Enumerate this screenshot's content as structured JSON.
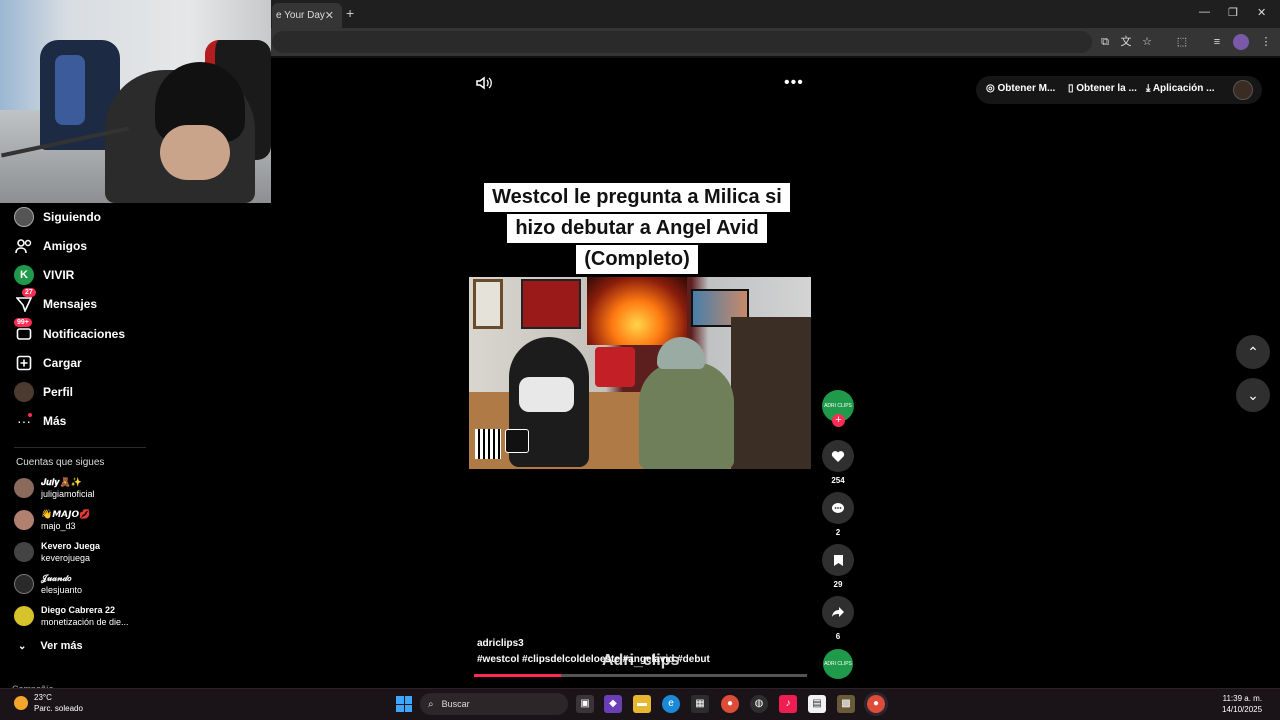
{
  "browser": {
    "tab_title": "e Your Day",
    "tab_close": "✕",
    "new_tab": "+",
    "window_controls": [
      "—",
      "❐",
      "✕"
    ]
  },
  "sidebar": {
    "items": [
      {
        "label": "Siguiendo",
        "icon": "following-icon"
      },
      {
        "label": "Amigos",
        "icon": "friends-icon"
      },
      {
        "label": "VIVIR",
        "icon": "live-icon",
        "glyph": "K"
      },
      {
        "label": "Mensajes",
        "icon": "messages-icon",
        "badge": "27"
      },
      {
        "label": "Notificaciones",
        "icon": "notifications-icon",
        "badge": "99+"
      },
      {
        "label": "Cargar",
        "icon": "upload-icon"
      },
      {
        "label": "Perfil",
        "icon": "profile-icon"
      },
      {
        "label": "Más",
        "icon": "more-icon"
      }
    ],
    "following_title": "Cuentas que sigues",
    "following": [
      {
        "nick": "𝑱𝒖𝒍𝒚🧸✨",
        "user": "juligiamoficial"
      },
      {
        "nick": "👋𝙈𝘼𝙅𝙊💋",
        "user": "majo_d3"
      },
      {
        "nick": "Kevero Juega",
        "user": "keverojuega"
      },
      {
        "nick": "𝒥𝓊𝒶𝓃𝒹𝑜",
        "user": "elesjuanto"
      },
      {
        "nick": "Diego Cabrera 22",
        "user": "monetización de die..."
      }
    ],
    "see_more": "Ver más",
    "cut_text": "Compañía"
  },
  "video": {
    "title_lines": [
      "Westcol le pregunta a Milica si",
      "hizo debutar a Angel Avid",
      "(Completo)"
    ],
    "author": "adriclips3",
    "hashtags": "#westcol  #clipsdelcoldeloeste #angelavid  #debut",
    "watermark": "Adri_clips",
    "progress": 0.26
  },
  "actions": {
    "creator_avatar_text": "ADRI CLIPS",
    "follow_plus": "+",
    "likes": "254",
    "comments": "2",
    "saves": "29",
    "shares": "6"
  },
  "top_right": {
    "btn1": "Obtener M...",
    "btn2": "Obtener la ...",
    "btn3": "Aplicación ..."
  },
  "taskbar": {
    "temp": "23°C",
    "weather": "Parc. soleado",
    "search_placeholder": "Buscar",
    "time": "11:39 a. m.",
    "date": "14/10/2025"
  }
}
